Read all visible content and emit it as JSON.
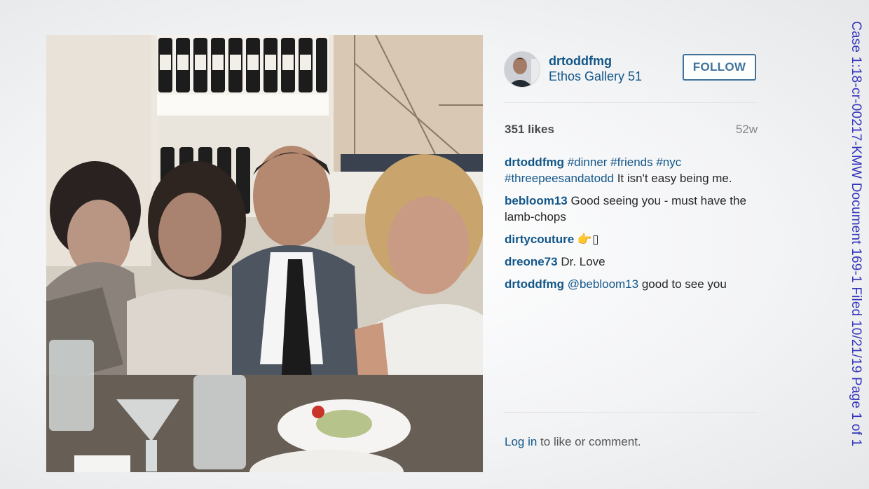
{
  "post": {
    "username": "drtoddfmg",
    "location": "Ethos Gallery 51",
    "follow_label": "FOLLOW",
    "likes": "351 likes",
    "age": "52w",
    "comments": [
      {
        "user": "drtoddfmg",
        "tags": "#dinner #friends #nyc #threepeesandatodd",
        "text": " It isn't easy being me."
      },
      {
        "user": "bebloom13",
        "tags": "",
        "text": " Good seeing you - must have the lamb-chops"
      },
      {
        "user": "dirtycouture",
        "tags": "",
        "text": " 👉▯"
      },
      {
        "user": "dreone73",
        "tags": "",
        "text": " Dr. Love"
      },
      {
        "user": "drtoddfmg",
        "tags": "@bebloom13",
        "text": " good to see you"
      }
    ],
    "footer": {
      "login_link": "Log in",
      "rest": " to like or comment."
    }
  },
  "stamp": "Case 1:18-cr-00217-KMW   Document 169-1   Filed 10/21/19   Page 1 of 1",
  "icons": {
    "avatar": "profile-photo",
    "photo": "dinner-photo"
  }
}
